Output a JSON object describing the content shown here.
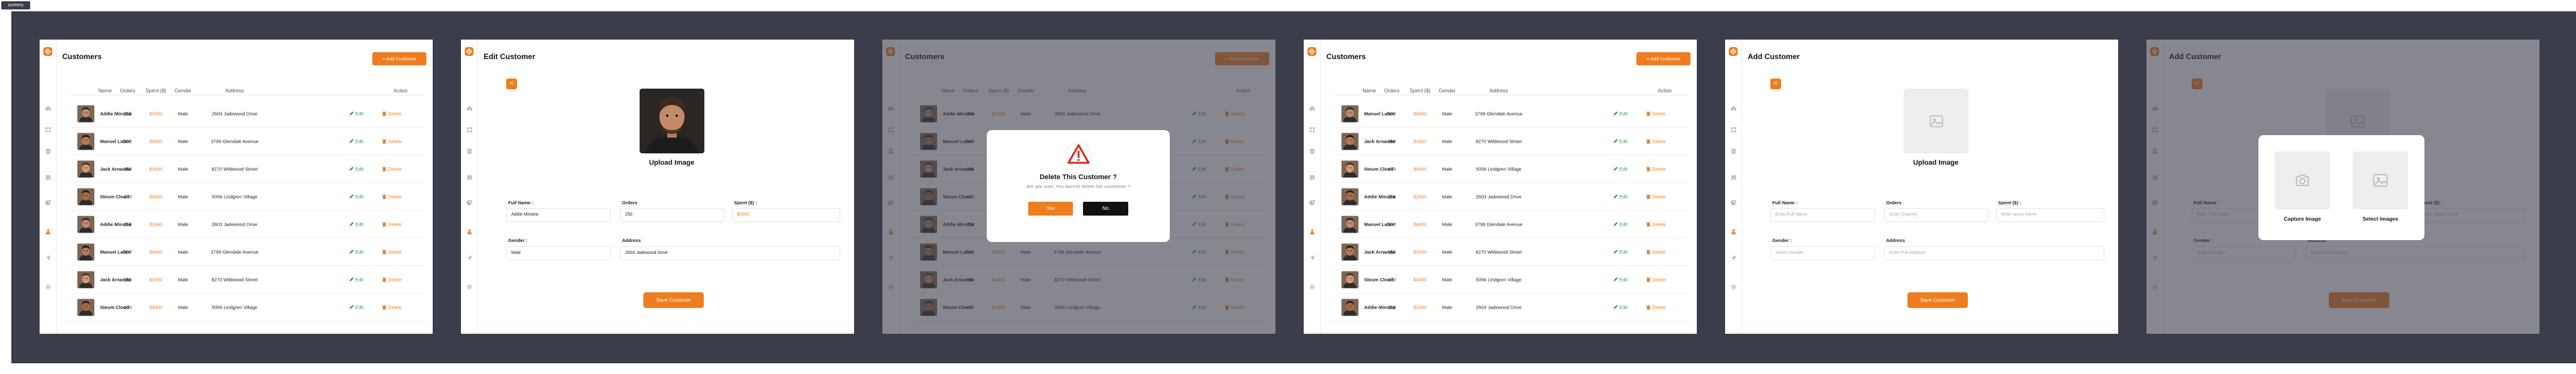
{
  "colors": {
    "accent": "#ee7d1f",
    "backdrop": "#3b3e4a",
    "edit": "#2e9d3e"
  },
  "tag": "screens",
  "table_headers": [
    "Name",
    "Orders",
    "Spent ($)",
    "Gender",
    "Address",
    "Action"
  ],
  "customers_a": [
    {
      "name": "Addie Minstra",
      "orders": "250",
      "spent": "$2600",
      "gender": "Male",
      "address": "2603 Jadewood Drive",
      "edit": "Edit",
      "delete": "Delete"
    },
    {
      "name": "Manuel Labor",
      "orders": "300",
      "spent": "$4800",
      "gender": "Male",
      "address": "3799 Glendale Avenue",
      "edit": "Edit",
      "delete": "Delete"
    },
    {
      "name": "Jack Arnanda",
      "orders": "260",
      "spent": "$2600",
      "gender": "Male",
      "address": "8270 Wildwood Street",
      "edit": "Edit",
      "delete": "Delete"
    },
    {
      "name": "Steum Clood",
      "orders": "400",
      "spent": "$4800",
      "gender": "Male",
      "address": "5056 Lindgren Village",
      "edit": "Edit",
      "delete": "Delete"
    },
    {
      "name": "Addie Minstra",
      "orders": "250",
      "spent": "$2600",
      "gender": "Male",
      "address": "2603 Jadewood Drive",
      "edit": "Edit",
      "delete": "Delete"
    },
    {
      "name": "Manuel Labor",
      "orders": "300",
      "spent": "$4800",
      "gender": "Male",
      "address": "3799 Glendale Avenue",
      "edit": "Edit",
      "delete": "Delete"
    },
    {
      "name": "Jack Arnanda",
      "orders": "260",
      "spent": "$2600",
      "gender": "Male",
      "address": "8270 Wildwood Street",
      "edit": "Edit",
      "delete": "Delete"
    },
    {
      "name": "Steum Clood",
      "orders": "400",
      "spent": "$4800",
      "gender": "Male",
      "address": "5056 Lindgren Village",
      "edit": "Edit",
      "delete": "Delete"
    }
  ],
  "customers_b": [
    {
      "name": "Manuel Labor",
      "orders": "300",
      "spent": "$4800",
      "gender": "Male",
      "address": "3799 Glendale Avenue",
      "edit": "Edit",
      "delete": "Delete"
    },
    {
      "name": "Jack Arnanda",
      "orders": "260",
      "spent": "$2600",
      "gender": "Male",
      "address": "8270 Wildwood Street",
      "edit": "Edit",
      "delete": "Delete"
    },
    {
      "name": "Steum Clood",
      "orders": "400",
      "spent": "$4800",
      "gender": "Male",
      "address": "5056 Lindgren Village",
      "edit": "Edit",
      "delete": "Delete"
    },
    {
      "name": "Addie Minstra",
      "orders": "250",
      "spent": "$2600",
      "gender": "Male",
      "address": "2603 Jadewood Drive",
      "edit": "Edit",
      "delete": "Delete"
    },
    {
      "name": "Manuel Labor",
      "orders": "300",
      "spent": "$4800",
      "gender": "Male",
      "address": "3799 Glendale Avenue",
      "edit": "Edit",
      "delete": "Delete"
    },
    {
      "name": "Jack Arnanda",
      "orders": "260",
      "spent": "$2600",
      "gender": "Male",
      "address": "8270 Wildwood Street",
      "edit": "Edit",
      "delete": "Delete"
    },
    {
      "name": "Steum Clood",
      "orders": "400",
      "spent": "$4800",
      "gender": "Male",
      "address": "5056 Lindgren Village",
      "edit": "Edit",
      "delete": "Delete"
    },
    {
      "name": "Addie Minstra",
      "orders": "250",
      "spent": "$2600",
      "gender": "Male",
      "address": "2603 Jadewood Drive",
      "edit": "Edit",
      "delete": "Delete"
    }
  ],
  "list": {
    "title": "Customers",
    "add_label": "+ Add Customer"
  },
  "edit": {
    "title": "Edit Customer",
    "back": "<",
    "upload": "Upload Image",
    "full_name_label": "Full Name :",
    "full_name": "Addie Minstra",
    "orders_label": "Orders",
    "orders": "250",
    "spent_label": "Spent ($) :",
    "spent": "$2600",
    "gender_label": "Gender :",
    "gender": "Male",
    "address_label": "Address",
    "address": "2603 Jadewood Drive",
    "save": "Save Customer"
  },
  "delete_modal": {
    "title": "Delete This Customer ?",
    "desc": "Are you sure, You want to delete this coustomer ?",
    "yes": "Yes",
    "no": "No"
  },
  "add": {
    "title": "Add Customer",
    "back": "<",
    "upload": "Upload Image",
    "full_name_label": "Full Name :",
    "full_name_ph": "Enter Full Name",
    "orders_label": "Orders",
    "orders_ph": "Enter Quantity",
    "spent_label": "Spent ($) :",
    "spent_ph": "Enter spent Name",
    "gender_label": "Gender :",
    "gender_ph": "Select Gender",
    "address_label": "Address",
    "address_ph": "Enter Full Address",
    "save": "Save Customer"
  },
  "image_modal": {
    "capture": "Capture Image",
    "select": "Select Images"
  },
  "icons": [
    "logo-icon",
    "home-icon",
    "grid-icon",
    "clipboard-icon",
    "store-icon",
    "pie-chart-icon",
    "users-icon",
    "send-icon",
    "settings-icon"
  ]
}
